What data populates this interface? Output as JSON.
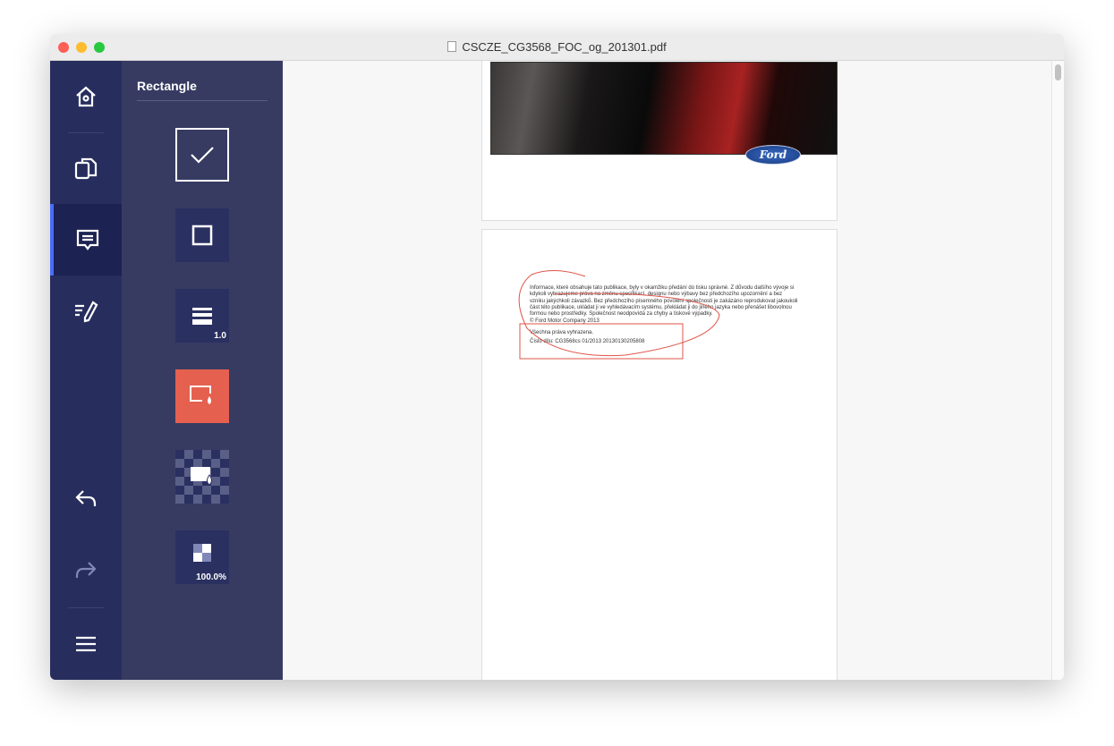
{
  "window": {
    "title": "CSCZE_CG3568_FOC_og_201301.pdf"
  },
  "nav": {
    "items": [
      "home",
      "pages",
      "comments",
      "signature"
    ],
    "undo": "undo",
    "redo": "redo",
    "menu": "menu"
  },
  "panel": {
    "title": "Rectangle",
    "stroke_width": "1.0",
    "opacity": "100.0%"
  },
  "colors": {
    "nav": "#272e5e",
    "panel": "#373b62",
    "accent": "#4a6cf7",
    "fill": "#e5604f",
    "annotation": "#e0554a"
  },
  "document": {
    "logo": "Ford",
    "paragraph": "Informace, které obsahuje tato publikace, byly v okamžiku předání do tisku správné. Z důvodu dalšího vývoje si kdykoli vyhrazujeme práva na změnu specifikací, designu nebo výbavy bez předchozího upozornění a bez vzniku jakýchkoli závazků. Bez předchozího písemného povolení společnosti je zakázáno reprodukovat jakoukoli část této publikace, ukládat ji ve vyhledávacím systému, překládat ji do jiného jazyka nebo přenášet libovolnou formou nebo prostředky. Společnost neodpovídá za chyby a tiskové výpadky.",
    "copyright": "© Ford Motor Company 2013",
    "rights": "Všechna práva vyhrazena.",
    "order": "Číslo dílu: CG3568cs 01/2013 20130130205808"
  }
}
